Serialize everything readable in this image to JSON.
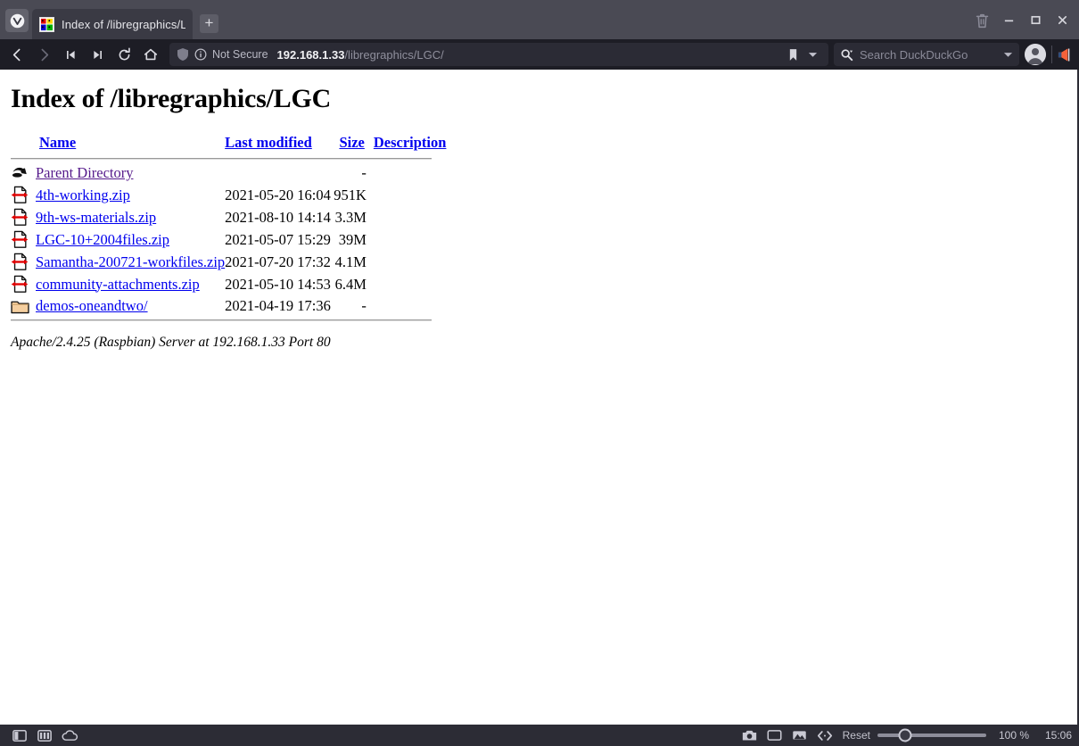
{
  "window": {
    "trash_icon": "trash-icon",
    "minimize_label": "Minimize",
    "maximize_label": "Maximize",
    "close_label": "Close"
  },
  "tabbar": {
    "vivaldi_logo": "vivaldi-logo",
    "tabs": [
      {
        "title": "Index of /libregraphics/LGC",
        "favicon": "apache-directory-favicon",
        "active": true
      }
    ],
    "new_tab_label": "+"
  },
  "toolbar": {
    "back_icon": "back-arrow-icon",
    "forward_icon": "forward-arrow-icon",
    "rewind_icon": "rewind-icon",
    "fastforward_icon": "fast-forward-icon",
    "reload_icon": "reload-icon",
    "home_icon": "home-icon",
    "shield_icon": "shield-icon",
    "info_icon": "info-circle-icon",
    "security_label": "Not Secure",
    "url_host": "192.168.1.33",
    "url_path": "/libregraphics/LGC/",
    "bookmark_icon": "bookmark-icon",
    "bookmark_chevron_icon": "chevron-down-icon",
    "search_icon": "search-icon",
    "search_placeholder": "Search DuckDuckGo",
    "search_value": "",
    "search_chevron_icon": "chevron-down-icon",
    "profile_icon": "profile-avatar-icon",
    "extension_icon": "megaphone-extension-icon"
  },
  "page": {
    "title": "Index of /libregraphics/LGC",
    "columns": {
      "icon": "",
      "name": "Name",
      "last_modified": "Last modified",
      "size": "Size",
      "description": "Description"
    },
    "rows": [
      {
        "icon": "parent-directory-icon",
        "name": "Parent Directory",
        "last_modified": "",
        "size": "-",
        "description": "",
        "visited": true
      },
      {
        "icon": "compressed-file-icon",
        "name": "4th-working.zip",
        "last_modified": "2021-05-20 16:04",
        "size": "951K",
        "description": "",
        "visited": false
      },
      {
        "icon": "compressed-file-icon",
        "name": "9th-ws-materials.zip",
        "last_modified": "2021-08-10 14:14",
        "size": "3.3M",
        "description": "",
        "visited": false
      },
      {
        "icon": "compressed-file-icon",
        "name": "LGC-10+2004files.zip",
        "last_modified": "2021-05-07 15:29",
        "size": "39M",
        "description": "",
        "visited": false
      },
      {
        "icon": "compressed-file-icon",
        "name": "Samantha-200721-workfiles.zip",
        "last_modified": "2021-07-20 17:32",
        "size": "4.1M",
        "description": "",
        "visited": false
      },
      {
        "icon": "compressed-file-icon",
        "name": "community-attachments.zip",
        "last_modified": "2021-05-10 14:53",
        "size": "6.4M",
        "description": "",
        "visited": false
      },
      {
        "icon": "folder-icon",
        "name": "demos-oneandtwo/",
        "last_modified": "2021-04-19 17:36",
        "size": "-",
        "description": "",
        "visited": false
      }
    ],
    "server_signature": "Apache/2.4.25 (Raspbian) Server at 192.168.1.33 Port 80"
  },
  "statusbar": {
    "panel_icon": "panel-toggle-icon",
    "tiling_icon": "tiling-icon",
    "cloud_icon": "cloud-icon",
    "capture_icon": "camera-icon",
    "window_icon": "window-icon",
    "image_icon": "image-icon",
    "devtools_icon": "code-brackets-icon",
    "reset_label": "Reset",
    "zoom_percent": "100 %",
    "zoom_value": 100,
    "clock": "15:06"
  },
  "colors": {
    "tabbar_bg": "#4a4a54",
    "toolbar_bg": "#1d1d25",
    "statusbar_bg": "#2c2c35",
    "link_blue": "#0000ee",
    "link_visited": "#551a8b",
    "page_bg": "#ffffff"
  }
}
